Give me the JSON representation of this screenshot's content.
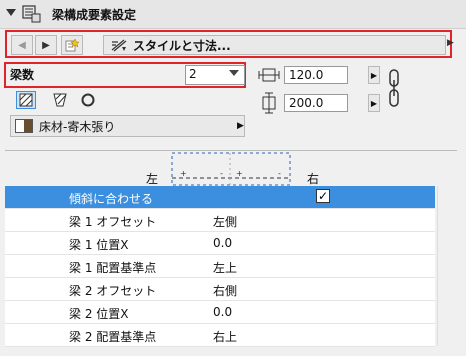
{
  "panel": {
    "title": "梁構成要素設定"
  },
  "nav": {
    "style_label": "スタイルと寸法..."
  },
  "beam_count": {
    "label": "梁数",
    "value": "2"
  },
  "dimensions": {
    "width": "120.0",
    "height": "200.0"
  },
  "material": {
    "label": "床材-寄木張り"
  },
  "preview": {
    "left_label": "左",
    "right_label": "右"
  },
  "table": {
    "rows": [
      {
        "label": "傾斜に合わせる",
        "value": "",
        "checked": true
      },
      {
        "label": "梁 1 オフセット",
        "value": "左側"
      },
      {
        "label": "梁 1 位置X",
        "value": "0.0"
      },
      {
        "label": "梁 1 配置基準点",
        "value": "左上"
      },
      {
        "label": "梁 2 オフセット",
        "value": "右側"
      },
      {
        "label": "梁 2 位置X",
        "value": "0.0"
      },
      {
        "label": "梁 2 配置基準点",
        "value": "右上"
      }
    ]
  },
  "colors": {
    "selection": "#3b8fde",
    "highlight_border": "#e0242a"
  }
}
